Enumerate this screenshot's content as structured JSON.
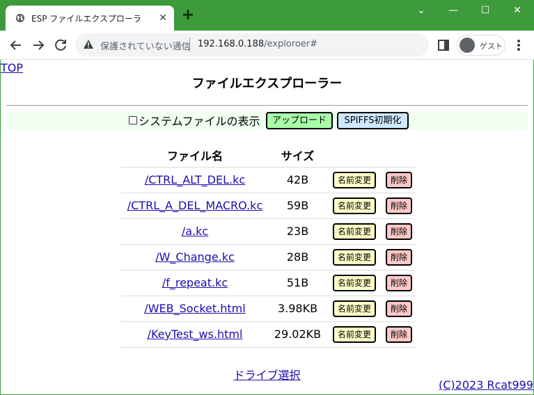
{
  "browser": {
    "tab_title": "ESP ファイルエクスプローラ",
    "security_text": "保護されていない通信",
    "url_host": "192.168.0.188",
    "url_path": "/exploroer#",
    "profile_label": "ゲスト"
  },
  "page": {
    "top_link": "TOP",
    "title": "ファイルエクスプローラー",
    "show_system_files_label": "システムファイルの表示",
    "upload_button": "アップロード",
    "init_button": "SPIFFS初期化",
    "table": {
      "headers": [
        "ファイル名",
        "サイズ"
      ],
      "rename_label": "名前変更",
      "delete_label": "削除",
      "rows": [
        {
          "name": "/CTRL_ALT_DEL.kc",
          "size": "42B"
        },
        {
          "name": "/CTRL_A_DEL_MACRO.kc",
          "size": "59B"
        },
        {
          "name": "/a.kc",
          "size": "23B"
        },
        {
          "name": "/W_Change.kc",
          "size": "28B"
        },
        {
          "name": "/f_repeat.kc",
          "size": "51B"
        },
        {
          "name": "/WEB_Socket.html",
          "size": "3.98KB"
        },
        {
          "name": "/KeyTest_ws.html",
          "size": "29.02KB"
        }
      ]
    },
    "drive_link": "ドライブ選択",
    "copyright": "(C)2023 Rcat999"
  },
  "colors": {
    "titlebar": "#3e9b3c",
    "upload_bg": "#a8ffa8",
    "init_bg": "#cfe8ff",
    "rename_bg": "#ffffc8",
    "delete_bg": "#ffc8c8",
    "link": "#1a0dab"
  }
}
